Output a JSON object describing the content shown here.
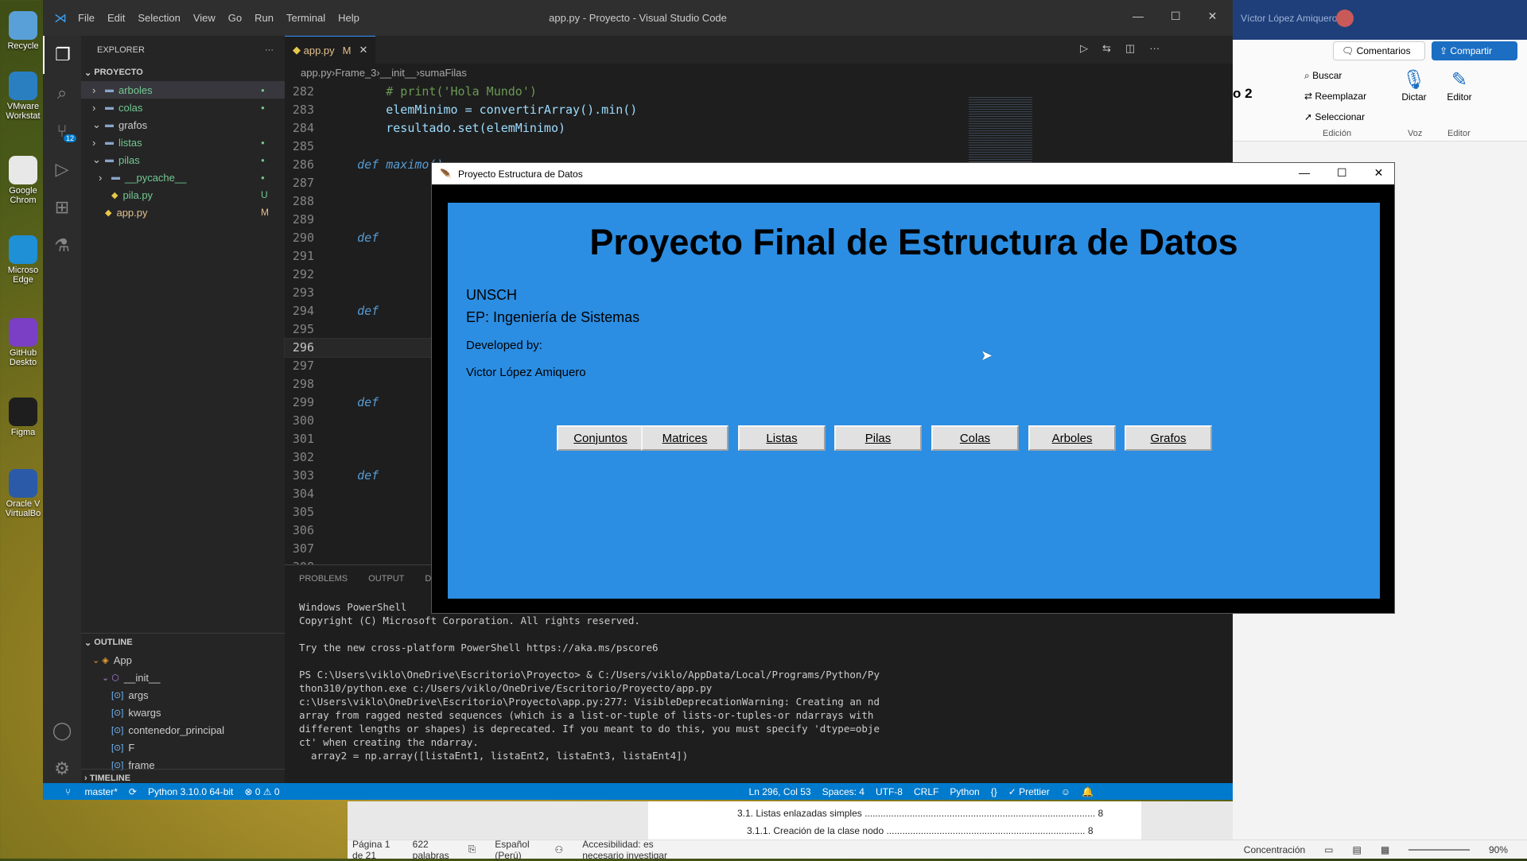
{
  "desktop": {
    "icons": [
      {
        "label": "Recycle",
        "color": "#5aa0d8"
      },
      {
        "label": "VMware Workstat",
        "color": "#2a7fc1"
      },
      {
        "label": "Google Chrom",
        "color": "#e8e8e8"
      },
      {
        "label": "Microso Edge",
        "color": "#1f8fd6"
      },
      {
        "label": "GitHub Deskto",
        "color": "#7a3fc4"
      },
      {
        "label": "Figma",
        "color": "#1e1e1e"
      },
      {
        "label": "Oracle V VirtualBo",
        "color": "#2b5aa8"
      }
    ]
  },
  "vscode": {
    "title": "app.py - Proyecto - Visual Studio Code",
    "menu": [
      "File",
      "Edit",
      "Selection",
      "View",
      "Go",
      "Run",
      "Terminal",
      "Help"
    ],
    "explorer_label": "EXPLORER",
    "project": "PROYECTO",
    "tree": [
      {
        "name": "arboles",
        "kind": "folder",
        "open": false,
        "badge": "dot",
        "indent": 0
      },
      {
        "name": "colas",
        "kind": "folder",
        "open": false,
        "badge": "dot",
        "indent": 0
      },
      {
        "name": "grafos",
        "kind": "folder",
        "open": true,
        "badge": "",
        "indent": 0
      },
      {
        "name": "listas",
        "kind": "folder",
        "open": false,
        "badge": "dot",
        "indent": 0
      },
      {
        "name": "pilas",
        "kind": "folder",
        "open": true,
        "badge": "dot",
        "indent": 0
      },
      {
        "name": "__pycache__",
        "kind": "folder",
        "open": false,
        "badge": "dot",
        "indent": 1
      },
      {
        "name": "pila.py",
        "kind": "py",
        "open": false,
        "badge": "U",
        "indent": 1
      },
      {
        "name": "app.py",
        "kind": "py",
        "open": false,
        "badge": "M",
        "indent": 0
      }
    ],
    "outline_label": "OUTLINE",
    "outline": [
      {
        "name": "App",
        "indent": 0
      },
      {
        "name": "__init__",
        "indent": 1
      },
      {
        "name": "args",
        "indent": 2
      },
      {
        "name": "kwargs",
        "indent": 2
      },
      {
        "name": "contenedor_principal",
        "indent": 2
      },
      {
        "name": "F",
        "indent": 2
      },
      {
        "name": "frame",
        "indent": 2
      }
    ],
    "timeline_label": "TIMELINE",
    "tab": {
      "name": "app.py",
      "mark": "M"
    },
    "breadcrumb": [
      "app.py",
      "Frame_3",
      "__init__",
      "sumaFilas"
    ],
    "code": [
      {
        "n": "282",
        "text": "        # print('Hola Mundo')"
      },
      {
        "n": "283",
        "text": "        elemMinimo = convertirArray().min()"
      },
      {
        "n": "284",
        "text": "        resultado.set(elemMinimo)"
      },
      {
        "n": "285",
        "text": ""
      },
      {
        "n": "286",
        "text": "    def maximo():"
      },
      {
        "n": "287",
        "text": ""
      },
      {
        "n": "288",
        "text": ""
      },
      {
        "n": "289",
        "text": ""
      },
      {
        "n": "290",
        "text": "    def"
      },
      {
        "n": "291",
        "text": ""
      },
      {
        "n": "292",
        "text": ""
      },
      {
        "n": "293",
        "text": ""
      },
      {
        "n": "294",
        "text": "    def"
      },
      {
        "n": "295",
        "text": ""
      },
      {
        "n": "296",
        "text": ""
      },
      {
        "n": "297",
        "text": ""
      },
      {
        "n": "298",
        "text": ""
      },
      {
        "n": "299",
        "text": "    def"
      },
      {
        "n": "300",
        "text": ""
      },
      {
        "n": "301",
        "text": ""
      },
      {
        "n": "302",
        "text": ""
      },
      {
        "n": "303",
        "text": "    def"
      },
      {
        "n": "304",
        "text": ""
      },
      {
        "n": "305",
        "text": ""
      },
      {
        "n": "306",
        "text": ""
      },
      {
        "n": "307",
        "text": ""
      },
      {
        "n": "308",
        "text": ""
      }
    ],
    "panel_tabs": [
      "PROBLEMS",
      "OUTPUT",
      "DEB"
    ],
    "terminal": "Windows PowerShell\nCopyright (C) Microsoft Corporation. All rights reserved.\n\nTry the new cross-platform PowerShell https://aka.ms/pscore6\n\nPS C:\\Users\\viklo\\OneDrive\\Escritorio\\Proyecto> & C:/Users/viklo/AppData/Local/Programs/Python/Py\nthon310/python.exe c:/Users/viklo/OneDrive/Escritorio/Proyecto/app.py\nc:\\Users\\viklo\\OneDrive\\Escritorio\\Proyecto\\app.py:277: VisibleDeprecationWarning: Creating an nd\narray from ragged nested sequences (which is a list-or-tuple of lists-or-tuples-or ndarrays with\ndifferent lengths or shapes) is deprecated. If you meant to do this, you must specify 'dtype=obje\nct' when creating the ndarray.\n  array2 = np.array([listaEnt1, listaEnt2, listaEnt3, listaEnt4])",
    "status": {
      "branch": "master*",
      "python": "Python 3.10.0 64-bit",
      "problems": "⊗ 0 ⚠ 0",
      "position": "Ln 296, Col 53",
      "spaces": "Spaces: 4",
      "encoding": "UTF-8",
      "eol": "CRLF",
      "language": "Python",
      "prettier": "✓ Prettier"
    },
    "scm_badge": "12"
  },
  "word": {
    "user": "Víctor López Amiquero",
    "comments": "Comentarios",
    "share": "Compartir",
    "style_partial": "o 2",
    "find": "Buscar",
    "replace": "Reemplazar",
    "select": "Seleccionar",
    "edition": "Edición",
    "dictate": "Dictar",
    "voice": "Voz",
    "editor": "Editor",
    "toc1": "3.1. Listas enlazadas simples ....................................................................................... 8",
    "toc2": "3.1.1. Creación de la clase nodo ........................................................................... 8",
    "status": {
      "page": "Página 1 de 21",
      "words": "622 palabras",
      "lang": "Español (Perú)",
      "access": "Accesibilidad: es necesario investigar",
      "focus": "Concentración",
      "zoom": "90%"
    }
  },
  "tk": {
    "title": "Proyecto Estructura de Datos",
    "heading": "Proyecto Final de Estructura de Datos",
    "line1": "UNSCH",
    "line2": "EP: Ingeniería de Sistemas",
    "dev_label": "Developed by:",
    "dev_name": "Victor López Amiquero",
    "buttons": [
      "Conjuntos",
      "Matrices",
      "Listas",
      "Pilas",
      "Colas",
      "Arboles",
      "Grafos"
    ]
  }
}
